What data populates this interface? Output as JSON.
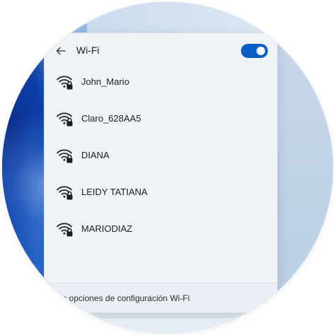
{
  "window": {
    "back_icon": "arrow-left-icon",
    "title": "Wi-Fi",
    "toggle_on": true,
    "accent": "#0b5cc4"
  },
  "networks": [
    {
      "name": "John_Mario",
      "icon": "wifi-secured-icon"
    },
    {
      "name": "Claro_628AA5",
      "icon": "wifi-secured-icon"
    },
    {
      "name": "DIANA",
      "icon": "wifi-secured-icon"
    },
    {
      "name": "LEIDY TATIANA",
      "icon": "wifi-secured-icon"
    },
    {
      "name": "MARIODIAZ",
      "icon": "wifi-secured-icon"
    }
  ],
  "footer": {
    "more_settings": "lás opciones de configuración Wi-Fi"
  }
}
